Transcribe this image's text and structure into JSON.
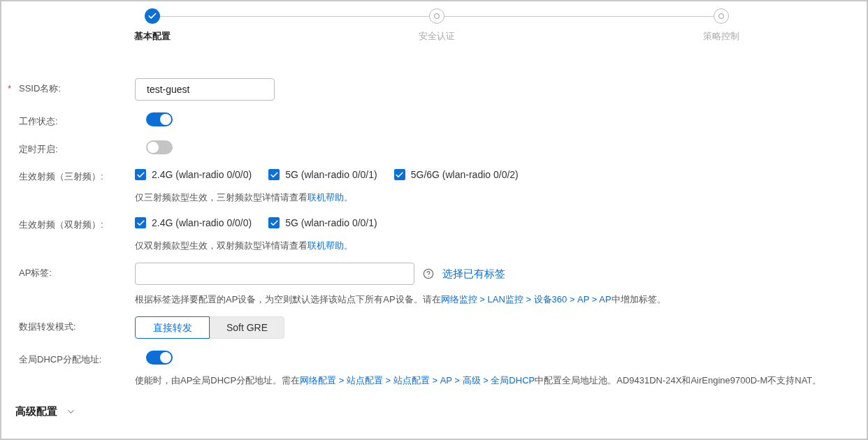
{
  "steps": [
    {
      "label": "基本配置",
      "done": true
    },
    {
      "label": "安全认证",
      "done": false
    },
    {
      "label": "策略控制",
      "done": false
    }
  ],
  "fields": [
    {
      "kind": "input",
      "label": "SSID名称:",
      "marker": "*",
      "value": "test-guest"
    },
    {
      "kind": "switch",
      "label": "工作状态:",
      "on": true
    },
    {
      "kind": "switch",
      "label": "定时开启:",
      "on": false
    },
    {
      "kind": "checkboxes",
      "label": "生效射频（三射频）:",
      "options": [
        {
          "label": "2.4G (wlan-radio 0/0/0)",
          "checked": true
        },
        {
          "label": "5G (wlan-radio 0/0/1)",
          "checked": true
        },
        {
          "label": "5G/6G (wlan-radio 0/0/2)",
          "checked": true
        }
      ],
      "hint": [
        {
          "text": "仅三射频款型生效，三射频款型详情请查看",
          "link": false
        },
        {
          "text": "联机帮助",
          "link": true
        },
        {
          "text": "。",
          "link": false
        }
      ]
    },
    {
      "kind": "checkboxes",
      "label": "生效射频（双射频）:",
      "options": [
        {
          "label": "2.4G (wlan-radio 0/0/0)",
          "checked": true
        },
        {
          "label": "5G (wlan-radio 0/0/1)",
          "checked": true
        }
      ],
      "hint": [
        {
          "text": "仅双射频款型生效，双射频款型详情请查看",
          "link": false
        },
        {
          "text": "联机帮助",
          "link": true
        },
        {
          "text": "。",
          "link": false
        }
      ]
    },
    {
      "kind": "tags",
      "label": "AP标签:",
      "action": "选择已有标签",
      "hint": [
        {
          "text": "根据标签选择要配置的AP设备，为空则默认选择该站点下所有AP设备。请在",
          "link": false
        },
        {
          "text": "网络监控 > LAN监控 > 设备360 > AP > AP",
          "link": true
        },
        {
          "text": "中增加标签。",
          "link": false
        }
      ]
    },
    {
      "kind": "segmented",
      "label": "数据转发模式:",
      "options": [
        {
          "label": "直接转发",
          "selected": true
        },
        {
          "label": "Soft GRE",
          "selected": false
        }
      ]
    },
    {
      "kind": "switch",
      "label": "全局DHCP分配地址:",
      "on": true,
      "hint": [
        {
          "text": "使能时，由AP全局DHCP分配地址。需在",
          "link": false
        },
        {
          "text": "网络配置 > 站点配置 > 站点配置 > AP > 高级 > 全局DHCP",
          "link": true
        },
        {
          "text": "中配置全局地址池。AD9431DN-24X和AirEngine9700D-M不支持NAT。",
          "link": false
        }
      ]
    }
  ],
  "advanced": {
    "label": "高级配置",
    "expanded": false
  }
}
